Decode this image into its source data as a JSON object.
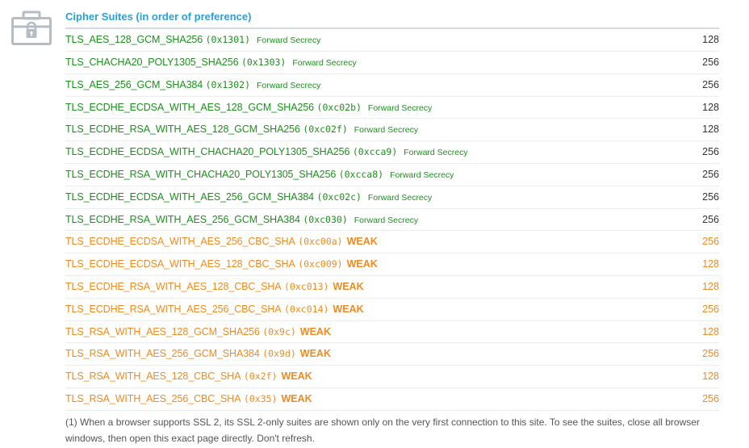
{
  "section": {
    "title": "Cipher Suites (in order of preference)",
    "icon": "toolbox-lock-icon"
  },
  "colors": {
    "title": "#2c9fd6",
    "good": "#1c8f1c",
    "weak": "#f08a1f",
    "bits_good": "#333333"
  },
  "suites": [
    {
      "name": "TLS_AES_128_GCM_SHA256",
      "code": "(0x1301)",
      "label": "Forward Secrecy",
      "status": "good",
      "bits": "128"
    },
    {
      "name": "TLS_CHACHA20_POLY1305_SHA256",
      "code": "(0x1303)",
      "label": "Forward Secrecy",
      "status": "good",
      "bits": "256"
    },
    {
      "name": "TLS_AES_256_GCM_SHA384",
      "code": "(0x1302)",
      "label": "Forward Secrecy",
      "status": "good",
      "bits": "256"
    },
    {
      "name": "TLS_ECDHE_ECDSA_WITH_AES_128_GCM_SHA256",
      "code": "(0xc02b)",
      "label": "Forward Secrecy",
      "status": "good",
      "bits": "128"
    },
    {
      "name": "TLS_ECDHE_RSA_WITH_AES_128_GCM_SHA256",
      "code": "(0xc02f)",
      "label": "Forward Secrecy",
      "status": "good",
      "bits": "128"
    },
    {
      "name": "TLS_ECDHE_ECDSA_WITH_CHACHA20_POLY1305_SHA256",
      "code": "(0xcca9)",
      "label": "Forward Secrecy",
      "status": "good",
      "bits": "256"
    },
    {
      "name": "TLS_ECDHE_RSA_WITH_CHACHA20_POLY1305_SHA256",
      "code": "(0xcca8)",
      "label": "Forward Secrecy",
      "status": "good",
      "bits": "256"
    },
    {
      "name": "TLS_ECDHE_ECDSA_WITH_AES_256_GCM_SHA384",
      "code": "(0xc02c)",
      "label": "Forward Secrecy",
      "status": "good",
      "bits": "256"
    },
    {
      "name": "TLS_ECDHE_RSA_WITH_AES_256_GCM_SHA384",
      "code": "(0xc030)",
      "label": "Forward Secrecy",
      "status": "good",
      "bits": "256"
    },
    {
      "name": "TLS_ECDHE_ECDSA_WITH_AES_256_CBC_SHA",
      "code": "(0xc00a)",
      "label": "WEAK",
      "status": "weak",
      "bits": "256"
    },
    {
      "name": "TLS_ECDHE_ECDSA_WITH_AES_128_CBC_SHA",
      "code": "(0xc009)",
      "label": "WEAK",
      "status": "weak",
      "bits": "128"
    },
    {
      "name": "TLS_ECDHE_RSA_WITH_AES_128_CBC_SHA",
      "code": "(0xc013)",
      "label": "WEAK",
      "status": "weak",
      "bits": "128"
    },
    {
      "name": "TLS_ECDHE_RSA_WITH_AES_256_CBC_SHA",
      "code": "(0xc014)",
      "label": "WEAK",
      "status": "weak",
      "bits": "256"
    },
    {
      "name": "TLS_RSA_WITH_AES_128_GCM_SHA256",
      "code": "(0x9c)",
      "label": "WEAK",
      "status": "weak",
      "bits": "128"
    },
    {
      "name": "TLS_RSA_WITH_AES_256_GCM_SHA384",
      "code": "(0x9d)",
      "label": "WEAK",
      "status": "weak",
      "bits": "256"
    },
    {
      "name": "TLS_RSA_WITH_AES_128_CBC_SHA",
      "code": "(0x2f)",
      "label": "WEAK",
      "status": "weak",
      "bits": "128"
    },
    {
      "name": "TLS_RSA_WITH_AES_256_CBC_SHA",
      "code": "(0x35)",
      "label": "WEAK",
      "status": "weak",
      "bits": "256"
    }
  ],
  "footnote": "(1) When a browser supports SSL 2, its SSL 2-only suites are shown only on the very first connection to this site. To see the suites, close all browser windows, then open this exact page directly. Don't refresh."
}
